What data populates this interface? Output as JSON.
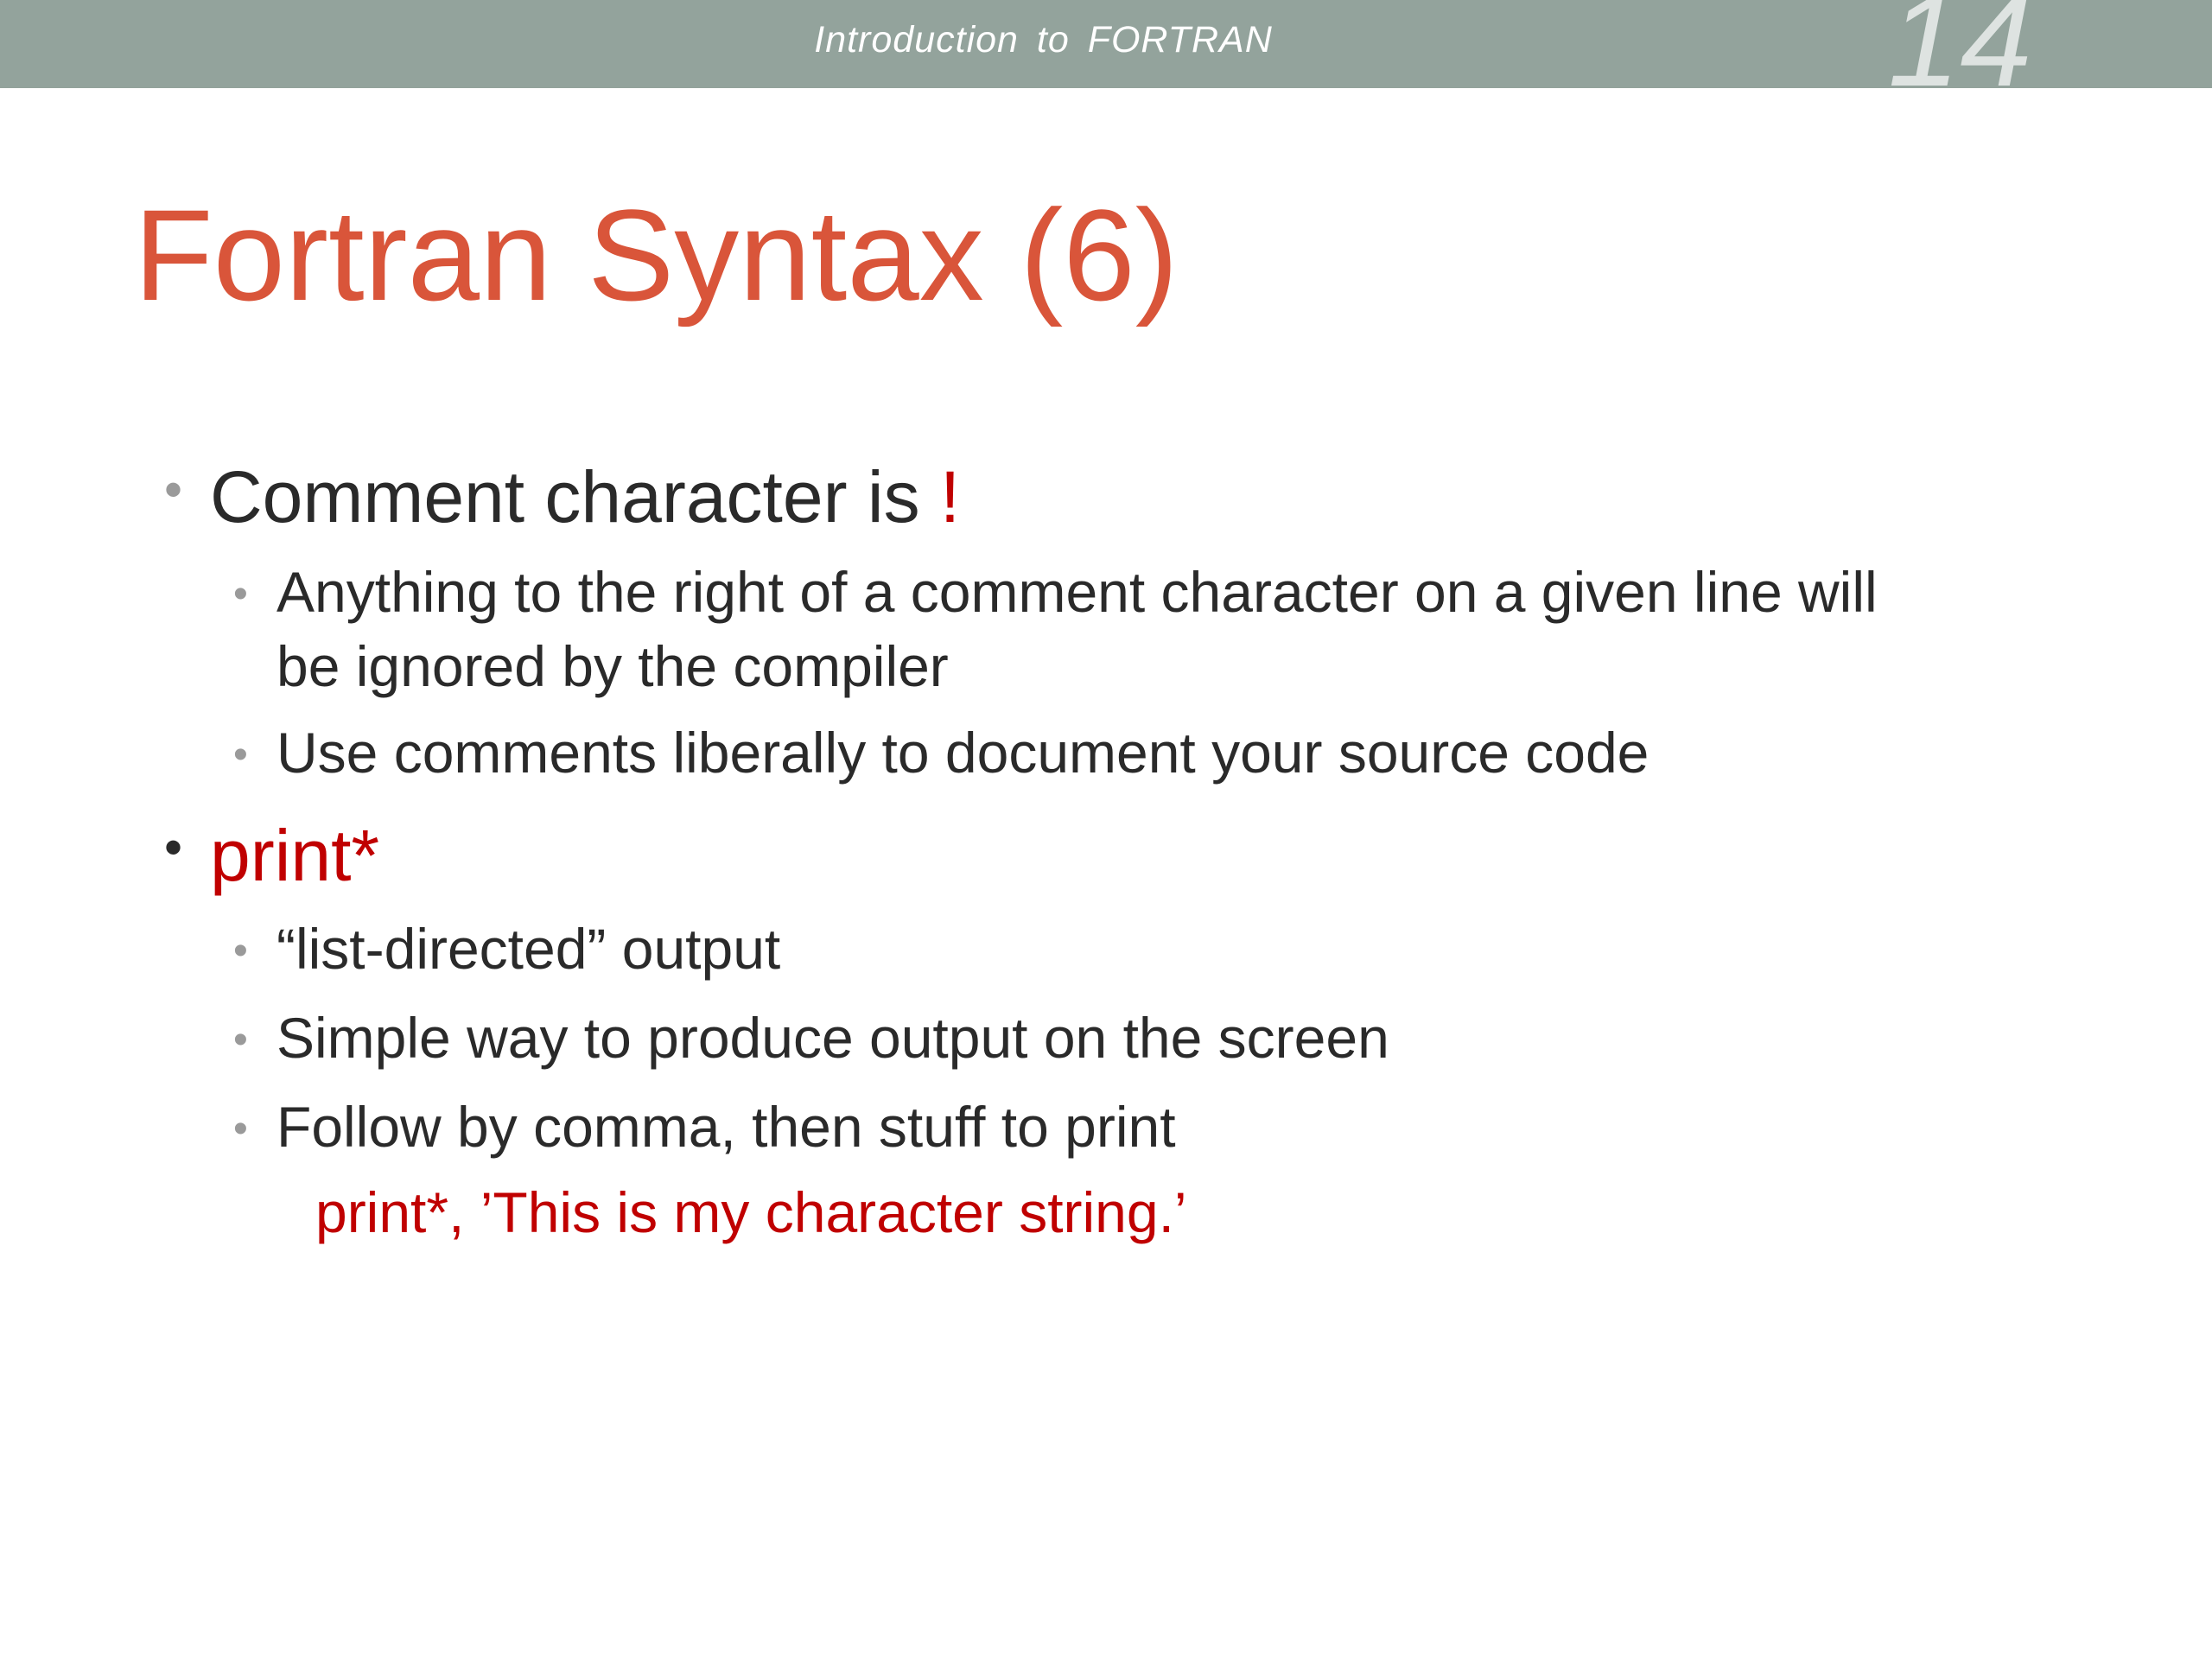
{
  "header": {
    "title": "Introduction  to  FORTRAN",
    "slide_number": "14"
  },
  "slide": {
    "title": "Fortran Syntax (6)",
    "bullets": [
      {
        "text": "Comment character is ",
        "highlight": "!",
        "sub": [
          {
            "line1": "Anything to the right of a comment character on a given line will",
            "line2": "be ignored by the compiler"
          },
          {
            "line1": "Use comments liberally to document your source code"
          }
        ]
      },
      {
        "highlight": "print*",
        "sub": [
          {
            "line1": "“list-directed” output"
          },
          {
            "line1": "Simple way to produce output on the screen"
          },
          {
            "line1": "Follow by comma, then stuff to print"
          }
        ],
        "code": "print*, ’This is my character string.’"
      }
    ]
  },
  "colors": {
    "header_bar": "#93a39c",
    "title": "#d9553a",
    "highlight": "#c00000",
    "body_text": "#2a2a2a"
  }
}
